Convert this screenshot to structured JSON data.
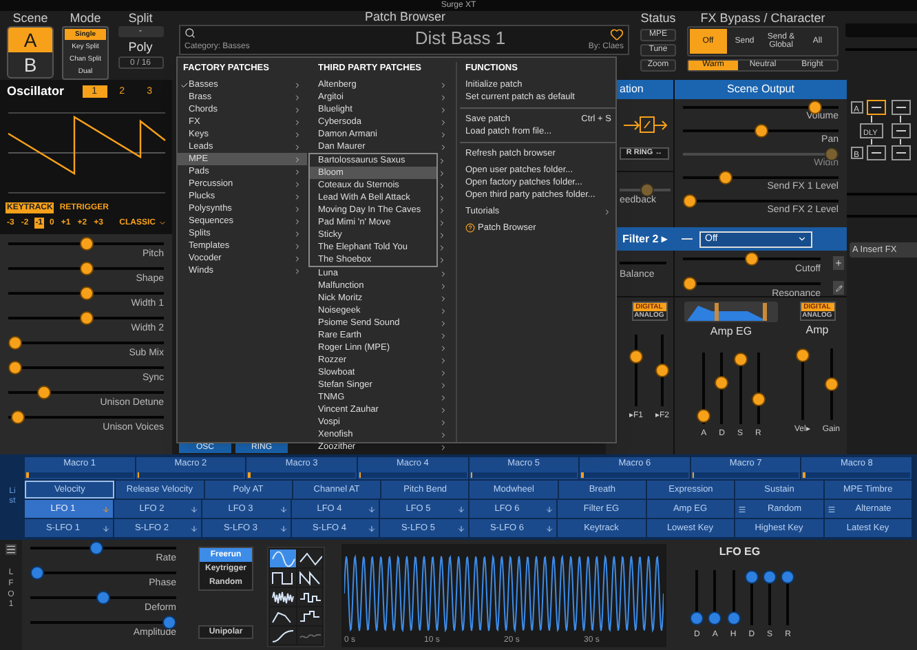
{
  "title_bar": {
    "title": "Surge XT"
  },
  "scene": {
    "label": "Scene",
    "options": [
      {
        "label": "A",
        "selected": true
      },
      {
        "label": "B",
        "selected": false
      }
    ]
  },
  "mode": {
    "label": "Mode",
    "options": [
      {
        "label": "Single",
        "selected": true
      },
      {
        "label": "Key Split",
        "selected": false
      },
      {
        "label": "Chan Split",
        "selected": false
      },
      {
        "label": "Dual",
        "selected": false
      }
    ]
  },
  "split": {
    "label": "Split",
    "value": "-"
  },
  "poly": {
    "label": "Poly",
    "value": "0 / 16"
  },
  "patch_browser": {
    "label": "Patch Browser",
    "category": "Category: Basses",
    "patch_name": "Dist Bass 1",
    "favorite": false,
    "author": "By: Claes"
  },
  "status": {
    "label": "Status",
    "buttons": [
      {
        "label": "MPE",
        "on": false
      },
      {
        "label": "Tune",
        "on": false
      },
      {
        "label": "Zoom",
        "on": false
      }
    ]
  },
  "fx_bypass": {
    "label": "FX Bypass / Character",
    "bypass": [
      {
        "label": "Off",
        "selected": true
      },
      {
        "label": "Send",
        "selected": false
      },
      {
        "label": "Send & Global",
        "selected": false
      },
      {
        "label": "All",
        "selected": false
      }
    ],
    "character": [
      {
        "label": "Warm",
        "selected": true
      },
      {
        "label": "Neutral",
        "selected": false
      },
      {
        "label": "Bright",
        "selected": false
      }
    ]
  },
  "oscillator": {
    "title": "Oscillator",
    "tabs": [
      {
        "label": "1",
        "selected": true
      },
      {
        "label": "2",
        "selected": false
      },
      {
        "label": "3",
        "selected": false
      }
    ],
    "keytrack": {
      "label": "KEYTRACK",
      "on": true
    },
    "retrigger": {
      "label": "RETRIGGER",
      "on": false
    },
    "octaves": [
      {
        "label": "-3",
        "selected": false
      },
      {
        "label": "-2",
        "selected": false
      },
      {
        "label": "-1",
        "selected": true
      },
      {
        "label": "0",
        "selected": false
      },
      {
        "label": "+1",
        "selected": false
      },
      {
        "label": "+2",
        "selected": false
      },
      {
        "label": "+3",
        "selected": false
      }
    ],
    "type": "CLASSIC",
    "sliders": [
      {
        "label": "Pitch",
        "level": 0.5
      },
      {
        "label": "Shape",
        "level": 0.5
      },
      {
        "label": "Width 1",
        "level": 0.5
      },
      {
        "label": "Width 2",
        "level": 0.5
      },
      {
        "label": "Sub Mix",
        "level": 0
      },
      {
        "label": "Sync",
        "level": 0
      },
      {
        "label": "Unison Detune",
        "level": 0.2
      },
      {
        "label": "Unison Voices",
        "level": 0.02
      }
    ],
    "routing_buttons": [
      "OSC",
      "RING"
    ]
  },
  "patch_menu": {
    "factory": {
      "heading": "FACTORY PATCHES",
      "items": [
        {
          "label": "Basses",
          "checked": true,
          "selected": false
        },
        {
          "label": "Brass",
          "checked": false,
          "selected": false
        },
        {
          "label": "Chords",
          "checked": false,
          "selected": false
        },
        {
          "label": "FX",
          "checked": false,
          "selected": false
        },
        {
          "label": "Keys",
          "checked": false,
          "selected": false
        },
        {
          "label": "Leads",
          "checked": false,
          "selected": false
        },
        {
          "label": "MPE",
          "checked": false,
          "selected": true,
          "submenu": [
            {
              "label": "Bartolossaurus Saxus",
              "selected": false
            },
            {
              "label": "Bloom",
              "selected": true
            },
            {
              "label": "Coteaux du Sternois",
              "selected": false
            },
            {
              "label": "Lead With A Bell Attack",
              "selected": false
            },
            {
              "label": "Moving Day In The Caves",
              "selected": false
            },
            {
              "label": "Pad Mimi 'n' Move",
              "selected": false
            },
            {
              "label": "Sticky",
              "selected": false
            },
            {
              "label": "The Elephant Told You",
              "selected": false
            },
            {
              "label": "The Shoebox",
              "selected": false
            }
          ]
        },
        {
          "label": "Pads",
          "checked": false,
          "selected": false
        },
        {
          "label": "Percussion",
          "checked": false,
          "selected": false
        },
        {
          "label": "Plucks",
          "checked": false,
          "selected": false
        },
        {
          "label": "Polysynths",
          "checked": false,
          "selected": false
        },
        {
          "label": "Sequences",
          "checked": false,
          "selected": false
        },
        {
          "label": "Splits",
          "checked": false,
          "selected": false
        },
        {
          "label": "Templates",
          "checked": false,
          "selected": false
        },
        {
          "label": "Vocoder",
          "checked": false,
          "selected": false
        },
        {
          "label": "Winds",
          "checked": false,
          "selected": false
        }
      ]
    },
    "third_party": {
      "heading": "THIRD PARTY PATCHES",
      "items": [
        "Altenberg",
        "Argitoi",
        "Bluelight",
        "Cybersoda",
        "Damon Armani",
        "Dan Maurer",
        "Luna",
        "Malfunction",
        "Nick Moritz",
        "Noisegeek",
        "Psiome Send Sound",
        "Rare Earth",
        "Roger Linn (MPE)",
        "Rozzer",
        "Slowboat",
        "Stefan Singer",
        "TNMG",
        "Vincent Zauhar",
        "Vospi",
        "Xenofish",
        "Zoozither"
      ]
    },
    "functions": {
      "heading": "FUNCTIONS",
      "groups": [
        [
          {
            "label": "Initialize patch",
            "kind": "item"
          },
          {
            "label": "Set current patch as default",
            "kind": "item"
          }
        ],
        [
          {
            "label": "Save patch",
            "kind": "item",
            "shortcut": "Ctrl + S"
          },
          {
            "label": "Load patch from file...",
            "kind": "item"
          }
        ],
        [
          {
            "label": "Refresh patch browser",
            "kind": "item"
          }
        ],
        [
          {
            "label": "Open user patches folder...",
            "kind": "item"
          },
          {
            "label": "Open factory patches folder...",
            "kind": "item"
          },
          {
            "label": "Open third party patches folder...",
            "kind": "item"
          }
        ],
        [
          {
            "label": "Tutorials",
            "kind": "submenu"
          }
        ],
        [
          {
            "label": "Patch Browser",
            "kind": "help"
          }
        ]
      ]
    }
  },
  "mixer": {
    "header": "ation",
    "ring_button": "R RING ↔",
    "feedback": {
      "label": "eedback",
      "level": 0.55
    },
    "balance": {
      "label": "Balance"
    }
  },
  "scene_output": {
    "title": "Scene Output",
    "sliders": [
      {
        "label": "Volume",
        "level": 0.88,
        "disabled": false
      },
      {
        "label": "Pan",
        "level": 0.5,
        "disabled": false
      },
      {
        "label": "Width",
        "level": 1,
        "disabled": true
      },
      {
        "label": "Send FX 1 Level",
        "level": 0.25,
        "disabled": false
      },
      {
        "label": "Send FX 2 Level",
        "level": 0,
        "disabled": false
      }
    ]
  },
  "filter2": {
    "label": "Filter 2 ▸",
    "type": "Off",
    "controls": [
      {
        "label": "Cutoff",
        "level": 0.5
      },
      {
        "label": "Resonance",
        "level": 0
      }
    ]
  },
  "filter_eg": {
    "modes": [
      {
        "label": "DIGITAL",
        "selected": true
      },
      {
        "label": "ANALOG",
        "selected": false
      }
    ],
    "sliders": [
      {
        "label": "▸F1",
        "level": 0.75
      },
      {
        "label": "▸F2",
        "level": 0.5
      }
    ]
  },
  "amp_eg": {
    "label": "Amp EG",
    "sliders": [
      {
        "label": "A",
        "level": 0.03
      },
      {
        "label": "D",
        "level": 0.6
      },
      {
        "label": "S",
        "level": 1
      },
      {
        "label": "R",
        "level": 0.3
      }
    ]
  },
  "amp": {
    "label": "Amp",
    "modes": [
      {
        "label": "DIGITAL",
        "selected": true
      },
      {
        "label": "ANALOG",
        "selected": false
      }
    ],
    "sliders": [
      {
        "label": "Vel▸",
        "level": 1
      },
      {
        "label": "Gain",
        "level": 0.5
      }
    ]
  },
  "fx_routing": {
    "labels": [
      "A",
      "DLY",
      "B"
    ],
    "insert_button": "A Insert FX"
  },
  "modulation": {
    "side_label": "List",
    "macros": [
      {
        "label": "Macro 1",
        "level": 0.02
      },
      {
        "label": "Macro 2",
        "level": 0.02
      },
      {
        "label": "Macro 3",
        "level": 0.02
      },
      {
        "label": "Macro 4",
        "level": 0.02
      },
      {
        "label": "Macro 5",
        "level": 0.02
      },
      {
        "label": "Macro 6",
        "level": 0.02
      },
      {
        "label": "Macro 7",
        "level": 0.02
      },
      {
        "label": "Macro 8",
        "level": 0.02
      }
    ],
    "rows": [
      [
        {
          "label": "Velocity",
          "kind": "plain",
          "selected": false,
          "focused": true
        },
        {
          "label": "Release Velocity",
          "kind": "plain",
          "selected": false,
          "focused": false
        },
        {
          "label": "Poly AT",
          "kind": "plain",
          "selected": false,
          "focused": false
        },
        {
          "label": "Channel AT",
          "kind": "plain",
          "selected": false,
          "focused": false
        },
        {
          "label": "Pitch Bend",
          "kind": "plain",
          "selected": false,
          "focused": false
        },
        {
          "label": "Modwheel",
          "kind": "plain",
          "selected": false,
          "focused": false
        },
        {
          "label": "Breath",
          "kind": "plain",
          "selected": false,
          "focused": false
        },
        {
          "label": "Expression",
          "kind": "plain",
          "selected": false,
          "focused": false
        },
        {
          "label": "Sustain",
          "kind": "plain",
          "selected": false,
          "focused": false
        },
        {
          "label": "MPE Timbre",
          "kind": "plain",
          "selected": false,
          "focused": false
        }
      ],
      [
        {
          "label": "LFO 1",
          "kind": "arrow",
          "selected": true,
          "focused": false
        },
        {
          "label": "LFO 2",
          "kind": "arrow",
          "selected": false,
          "focused": false
        },
        {
          "label": "LFO 3",
          "kind": "arrow",
          "selected": false,
          "focused": false
        },
        {
          "label": "LFO 4",
          "kind": "arrow",
          "selected": false,
          "focused": false
        },
        {
          "label": "LFO 5",
          "kind": "arrow",
          "selected": false,
          "focused": false
        },
        {
          "label": "LFO 6",
          "kind": "arrow",
          "selected": false,
          "focused": false
        },
        {
          "label": "Filter EG",
          "kind": "plain",
          "selected": false,
          "focused": false
        },
        {
          "label": "Amp EG",
          "kind": "plain",
          "selected": false,
          "focused": false
        },
        {
          "label": "Random",
          "kind": "menu",
          "selected": false,
          "focused": false
        },
        {
          "label": "Alternate",
          "kind": "menu",
          "selected": false,
          "focused": false
        }
      ],
      [
        {
          "label": "S-LFO 1",
          "kind": "arrow",
          "selected": false,
          "focused": false
        },
        {
          "label": "S-LFO 2",
          "kind": "arrow",
          "selected": false,
          "focused": false
        },
        {
          "label": "S-LFO 3",
          "kind": "arrow",
          "selected": false,
          "focused": false
        },
        {
          "label": "S-LFO 4",
          "kind": "arrow",
          "selected": false,
          "focused": false
        },
        {
          "label": "S-LFO 5",
          "kind": "arrow",
          "selected": false,
          "focused": false
        },
        {
          "label": "S-LFO 6",
          "kind": "arrow",
          "selected": false,
          "focused": false
        },
        {
          "label": "Keytrack",
          "kind": "plain",
          "selected": false,
          "focused": false
        },
        {
          "label": "Lowest Key",
          "kind": "plain",
          "selected": false,
          "focused": false
        },
        {
          "label": "Highest Key",
          "kind": "plain",
          "selected": false,
          "focused": false
        },
        {
          "label": "Latest Key",
          "kind": "plain",
          "selected": false,
          "focused": false
        }
      ]
    ]
  },
  "lfo": {
    "label": "LFO 1",
    "sliders": [
      {
        "label": "Rate",
        "level": 0.45
      },
      {
        "label": "Phase",
        "level": 0
      },
      {
        "label": "Deform",
        "level": 0.5
      },
      {
        "label": "Amplitude",
        "level": 1
      }
    ],
    "trigger": [
      {
        "label": "Freerun",
        "selected": true
      },
      {
        "label": "Keytrigger",
        "selected": false
      },
      {
        "label": "Random",
        "selected": false
      }
    ],
    "unipolar": {
      "label": "Unipolar",
      "on": false
    },
    "shapes": [
      {
        "kind": "sine",
        "selected": true
      },
      {
        "kind": "triangle",
        "selected": false
      },
      {
        "kind": "square",
        "selected": false
      },
      {
        "kind": "saw",
        "selected": false
      },
      {
        "kind": "noise",
        "selected": false
      },
      {
        "kind": "sample_hold",
        "selected": false
      },
      {
        "kind": "envelope",
        "selected": false
      },
      {
        "kind": "step_seq",
        "selected": false
      },
      {
        "kind": "curve",
        "selected": false
      },
      {
        "kind": "formula",
        "selected": false
      }
    ],
    "ticks": [
      "0 s",
      "10 s",
      "20 s",
      "30 s"
    ],
    "eg": {
      "label": "LFO EG",
      "sliders": [
        {
          "label": "D",
          "level": 0
        },
        {
          "label": "A",
          "level": 0
        },
        {
          "label": "H",
          "level": 0
        },
        {
          "label": "D",
          "level": 1
        },
        {
          "label": "S",
          "level": 1
        },
        {
          "label": "R",
          "level": 1
        }
      ]
    }
  }
}
